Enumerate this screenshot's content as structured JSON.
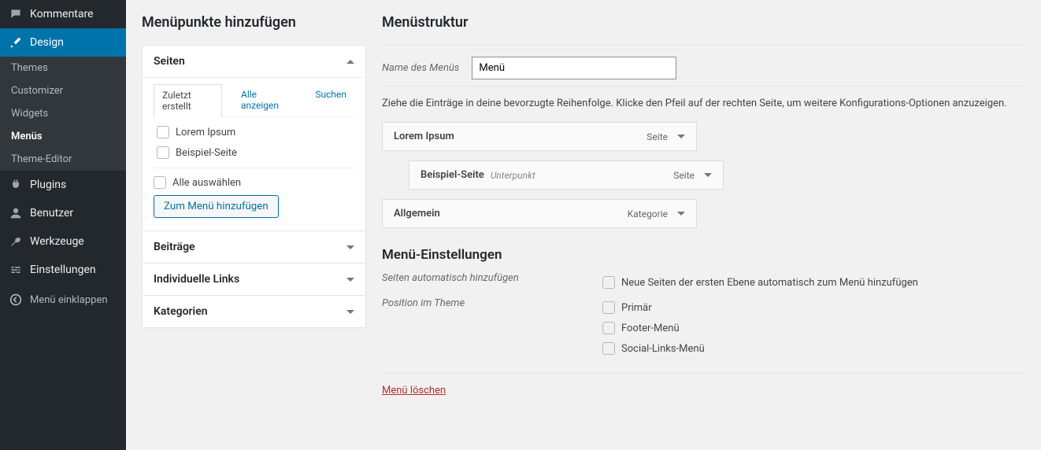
{
  "sidebar": {
    "items": [
      {
        "label": "Kommentare",
        "icon": "comment"
      },
      {
        "label": "Design",
        "icon": "brush",
        "active": true
      },
      {
        "label": "Plugins",
        "icon": "plug"
      },
      {
        "label": "Benutzer",
        "icon": "user"
      },
      {
        "label": "Werkzeuge",
        "icon": "wrench"
      },
      {
        "label": "Einstellungen",
        "icon": "sliders"
      }
    ],
    "submenu": [
      {
        "label": "Themes"
      },
      {
        "label": "Customizer"
      },
      {
        "label": "Widgets"
      },
      {
        "label": "Menüs",
        "current": true
      },
      {
        "label": "Theme-Editor"
      }
    ],
    "collapse": "Menü einklappen"
  },
  "left": {
    "heading": "Menüpunkte hinzufügen",
    "box_seiten": "Seiten",
    "tabs": {
      "recent": "Zuletzt erstellt",
      "all": "Alle anzeigen",
      "search": "Suchen"
    },
    "items": [
      "Lorem Ipsum",
      "Beispiel-Seite"
    ],
    "select_all": "Alle auswählen",
    "add_btn": "Zum Menü hinzufügen",
    "box_posts": "Beiträge",
    "box_links": "Individuelle Links",
    "box_cats": "Kategorien"
  },
  "right": {
    "heading": "Menüstruktur",
    "name_label": "Name des Menüs",
    "name_value": "Menü",
    "helper": "Ziehe die Einträge in deine bevorzugte Reihenfolge. Klicke den Pfeil auf der rechten Seite, um weitere Konfigurations-Optionen anzuzeigen.",
    "menu_items": [
      {
        "title": "Lorem Ipsum",
        "type": "Seite",
        "child": false
      },
      {
        "title": "Beispiel-Seite",
        "subtitle": "Unterpunkt",
        "type": "Seite",
        "child": true
      },
      {
        "title": "Allgemein",
        "type": "Kategorie",
        "child": false
      }
    ],
    "settings_heading": "Menü-Einstellungen",
    "auto_add_label": "Seiten automatisch hinzufügen",
    "auto_add_option": "Neue Seiten der ersten Ebene automatisch zum Menü hinzufügen",
    "position_label": "Position im Theme",
    "positions": [
      "Primär",
      "Footer-Menü",
      "Social-Links-Menü"
    ],
    "delete": "Menü löschen"
  }
}
